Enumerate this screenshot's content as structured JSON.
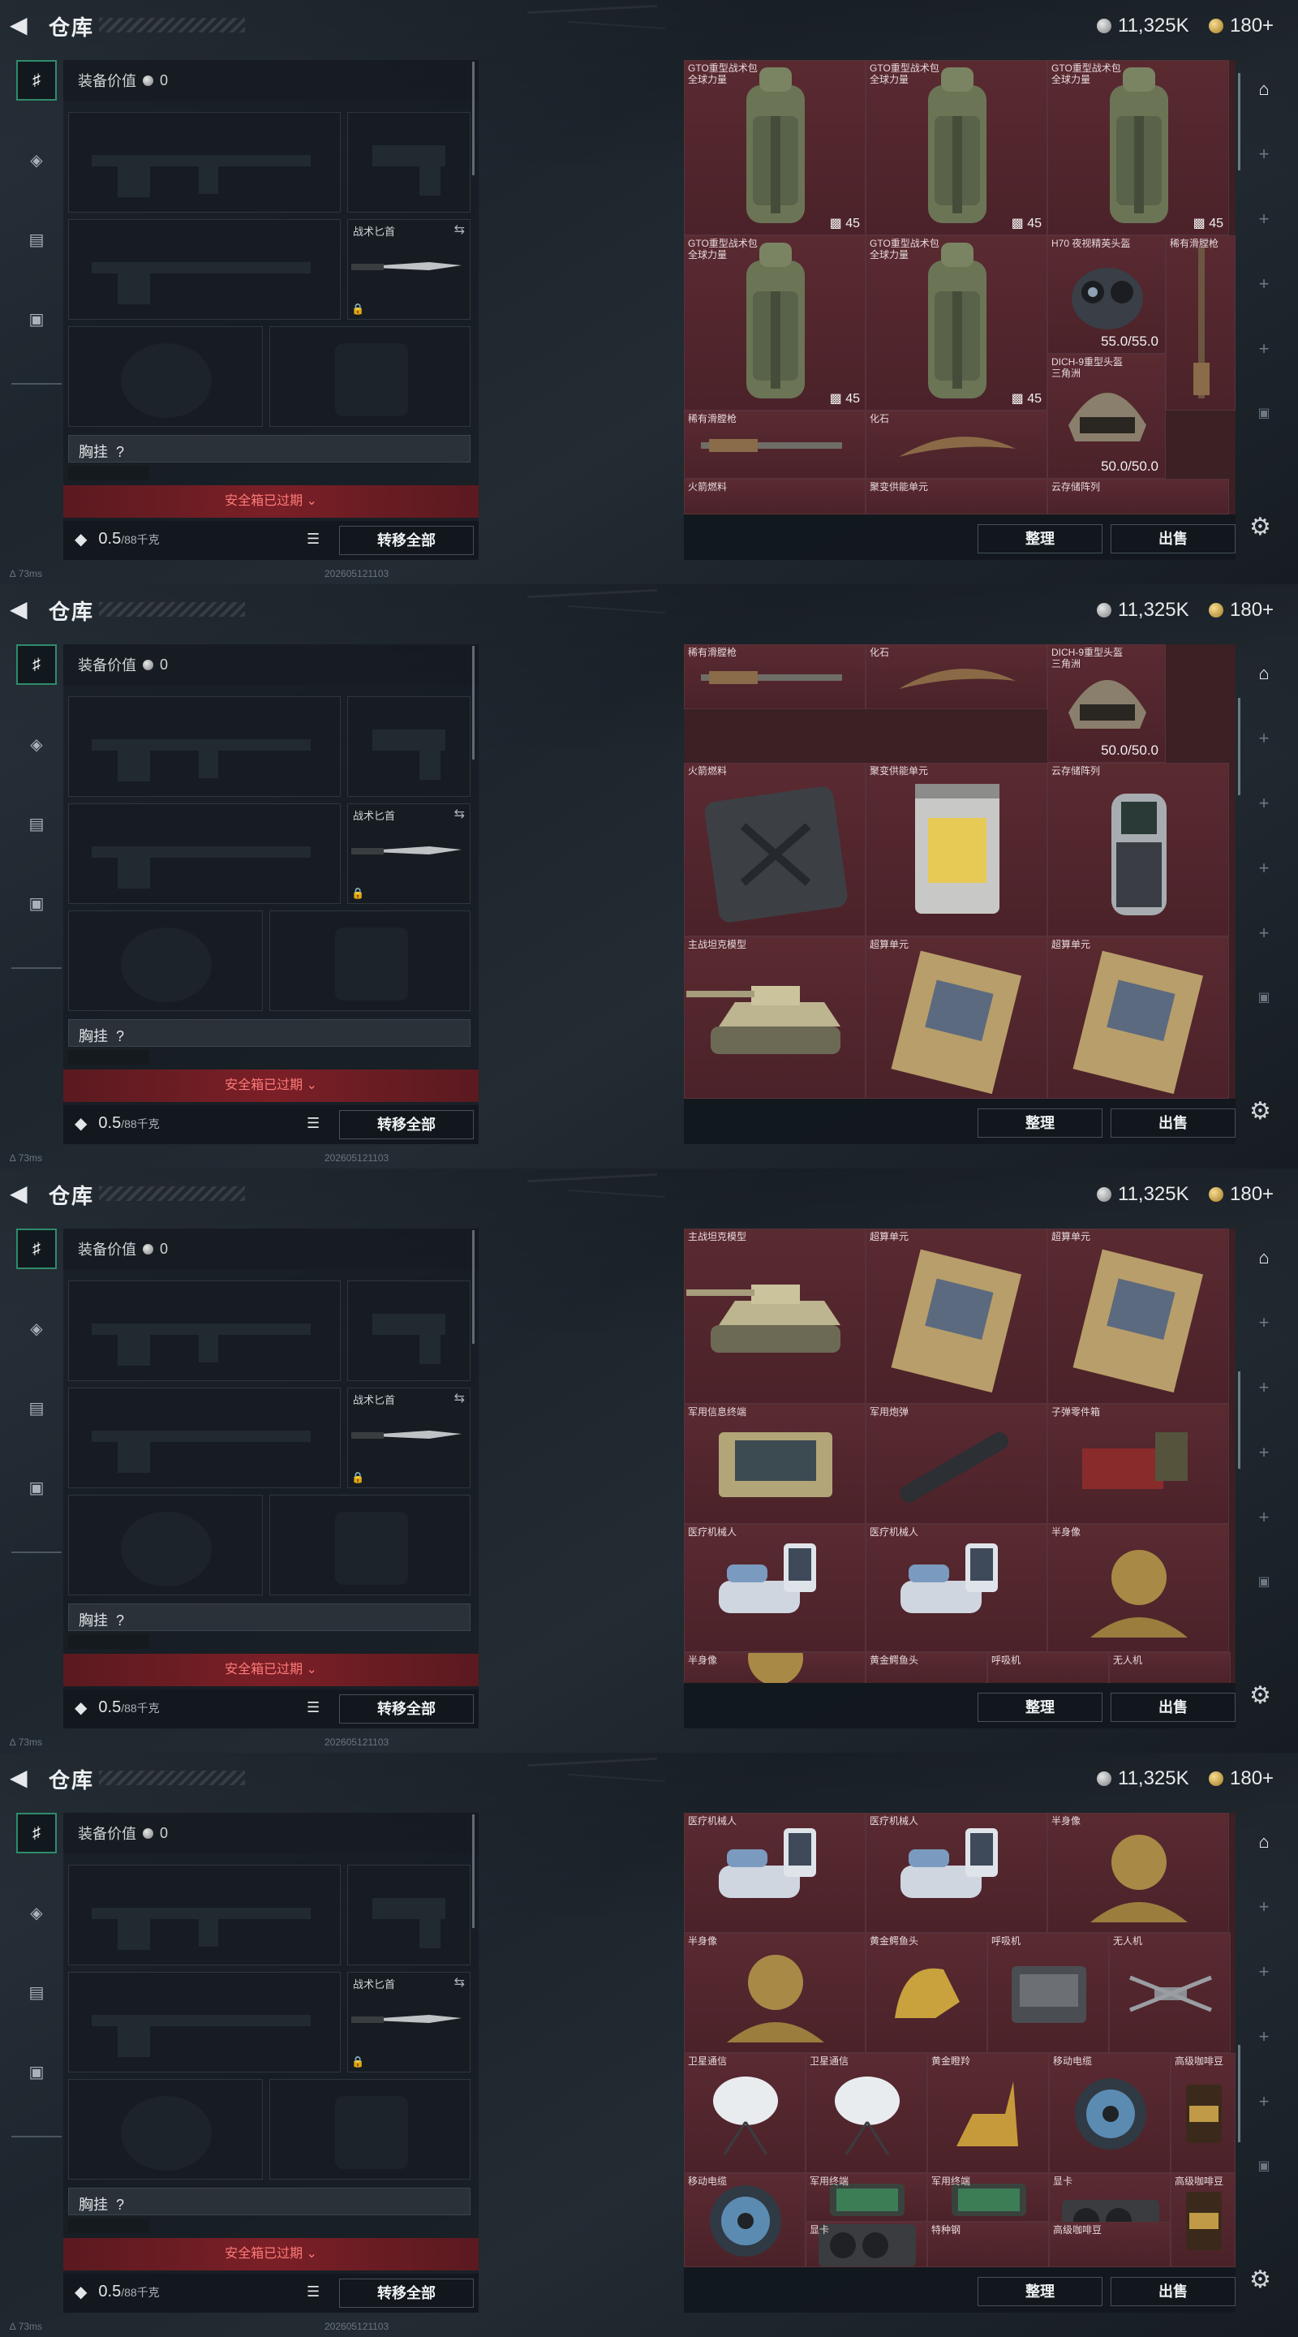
{
  "topbar": {
    "back_icon": "back-arrow-icon",
    "title": "仓库",
    "silver": "11,325K",
    "gold": "180+"
  },
  "tabs": [
    {
      "icon": "pistol-icon"
    },
    {
      "icon": "badge-icon"
    },
    {
      "icon": "clipboard-icon"
    },
    {
      "icon": "briefcase-icon"
    }
  ],
  "loadout": {
    "equip_value_label": "装备价值",
    "equip_value": "0",
    "knife_label": "战术匕首",
    "chest_label": "胸挂",
    "chest_q": "?",
    "expired": "安全箱已过期",
    "weight": "0.5",
    "weight_unit": "/88千克",
    "transfer_all": "转移全部"
  },
  "status": {
    "ping": "73ms",
    "stamp": "202605121103"
  },
  "stash_buttons": {
    "sort": "整理",
    "sell": "出售"
  },
  "frames": [
    {
      "cells": [
        {
          "name": "GTO重型战术包",
          "sub": "全球力量",
          "badge": "45"
        },
        {
          "name": "GTO重型战术包",
          "sub": "全球力量",
          "badge": "45"
        },
        {
          "name": "GTO重型战术包",
          "sub": "全球力量",
          "badge": "45"
        },
        {
          "name": "GTO重型战术包",
          "sub": "全球力量",
          "badge": "45"
        },
        {
          "name": "GTO重型战术包",
          "sub": "全球力量",
          "badge": "45"
        },
        {
          "name": "H70 夜视精英头盔",
          "sub": "",
          "dura": "55.0/55.0"
        },
        {
          "name": "稀有滑膛枪",
          "sub": ""
        },
        {
          "name": "DICH-9重型头盔",
          "sub": "三角洲",
          "dura": "50.0/50.0"
        },
        {
          "name": "稀有滑膛枪",
          "sub": ""
        },
        {
          "name": "化石",
          "sub": ""
        },
        {
          "name": "火箭燃料",
          "sub": ""
        },
        {
          "name": "聚变供能单元",
          "sub": ""
        },
        {
          "name": "云存储阵列",
          "sub": ""
        }
      ]
    },
    {
      "cells": [
        {
          "name": "DICH-9重型头盔",
          "sub": "三角洲",
          "dura": "50.0/50.0"
        },
        {
          "name": "稀有滑膛枪",
          "sub": ""
        },
        {
          "name": "化石",
          "sub": ""
        },
        {
          "name": "火箭燃料",
          "sub": ""
        },
        {
          "name": "聚变供能单元",
          "sub": ""
        },
        {
          "name": "云存储阵列",
          "sub": ""
        },
        {
          "name": "主战坦克模型",
          "sub": ""
        },
        {
          "name": "超算单元",
          "sub": ""
        },
        {
          "name": "超算单元",
          "sub": ""
        }
      ]
    },
    {
      "cells": [
        {
          "name": "主战坦克模型",
          "sub": ""
        },
        {
          "name": "超算单元",
          "sub": ""
        },
        {
          "name": "超算单元",
          "sub": ""
        },
        {
          "name": "军用信息终端",
          "sub": ""
        },
        {
          "name": "军用炮弹",
          "sub": ""
        },
        {
          "name": "子弹零件箱",
          "sub": ""
        },
        {
          "name": "医疗机械人",
          "sub": ""
        },
        {
          "name": "医疗机械人",
          "sub": ""
        },
        {
          "name": "半身像",
          "sub": ""
        },
        {
          "name": "半身像",
          "sub": ""
        },
        {
          "name": "黄金鳄鱼头",
          "sub": ""
        },
        {
          "name": "呼吸机",
          "sub": ""
        },
        {
          "name": "无人机",
          "sub": ""
        }
      ]
    },
    {
      "cells": [
        {
          "name": "医疗机械人",
          "sub": ""
        },
        {
          "name": "医疗机械人",
          "sub": ""
        },
        {
          "name": "半身像",
          "sub": ""
        },
        {
          "name": "半身像",
          "sub": ""
        },
        {
          "name": "黄金鳄鱼头",
          "sub": ""
        },
        {
          "name": "呼吸机",
          "sub": ""
        },
        {
          "name": "无人机",
          "sub": ""
        },
        {
          "name": "卫星通信",
          "sub": ""
        },
        {
          "name": "卫星通信",
          "sub": ""
        },
        {
          "name": "黄金瞪羚",
          "sub": ""
        },
        {
          "name": "移动电缆",
          "sub": ""
        },
        {
          "name": "高级咖啡豆",
          "sub": ""
        },
        {
          "name": "移动电缆",
          "sub": ""
        },
        {
          "name": "军用终端",
          "sub": ""
        },
        {
          "name": "军用终端",
          "sub": ""
        },
        {
          "name": "显卡",
          "sub": ""
        },
        {
          "name": "高级咖啡豆",
          "sub": ""
        },
        {
          "name": "显卡",
          "sub": ""
        },
        {
          "name": "特种钢",
          "sub": ""
        },
        {
          "name": "高级咖啡豆",
          "sub": ""
        }
      ]
    }
  ],
  "rail": [
    {
      "icon": "stash-icon"
    },
    {
      "icon": "plus-icon"
    },
    {
      "icon": "plus-icon"
    },
    {
      "icon": "plus-icon"
    },
    {
      "icon": "plus-icon"
    },
    {
      "icon": "lock-icon"
    }
  ],
  "settings_icon": "gear-icon"
}
